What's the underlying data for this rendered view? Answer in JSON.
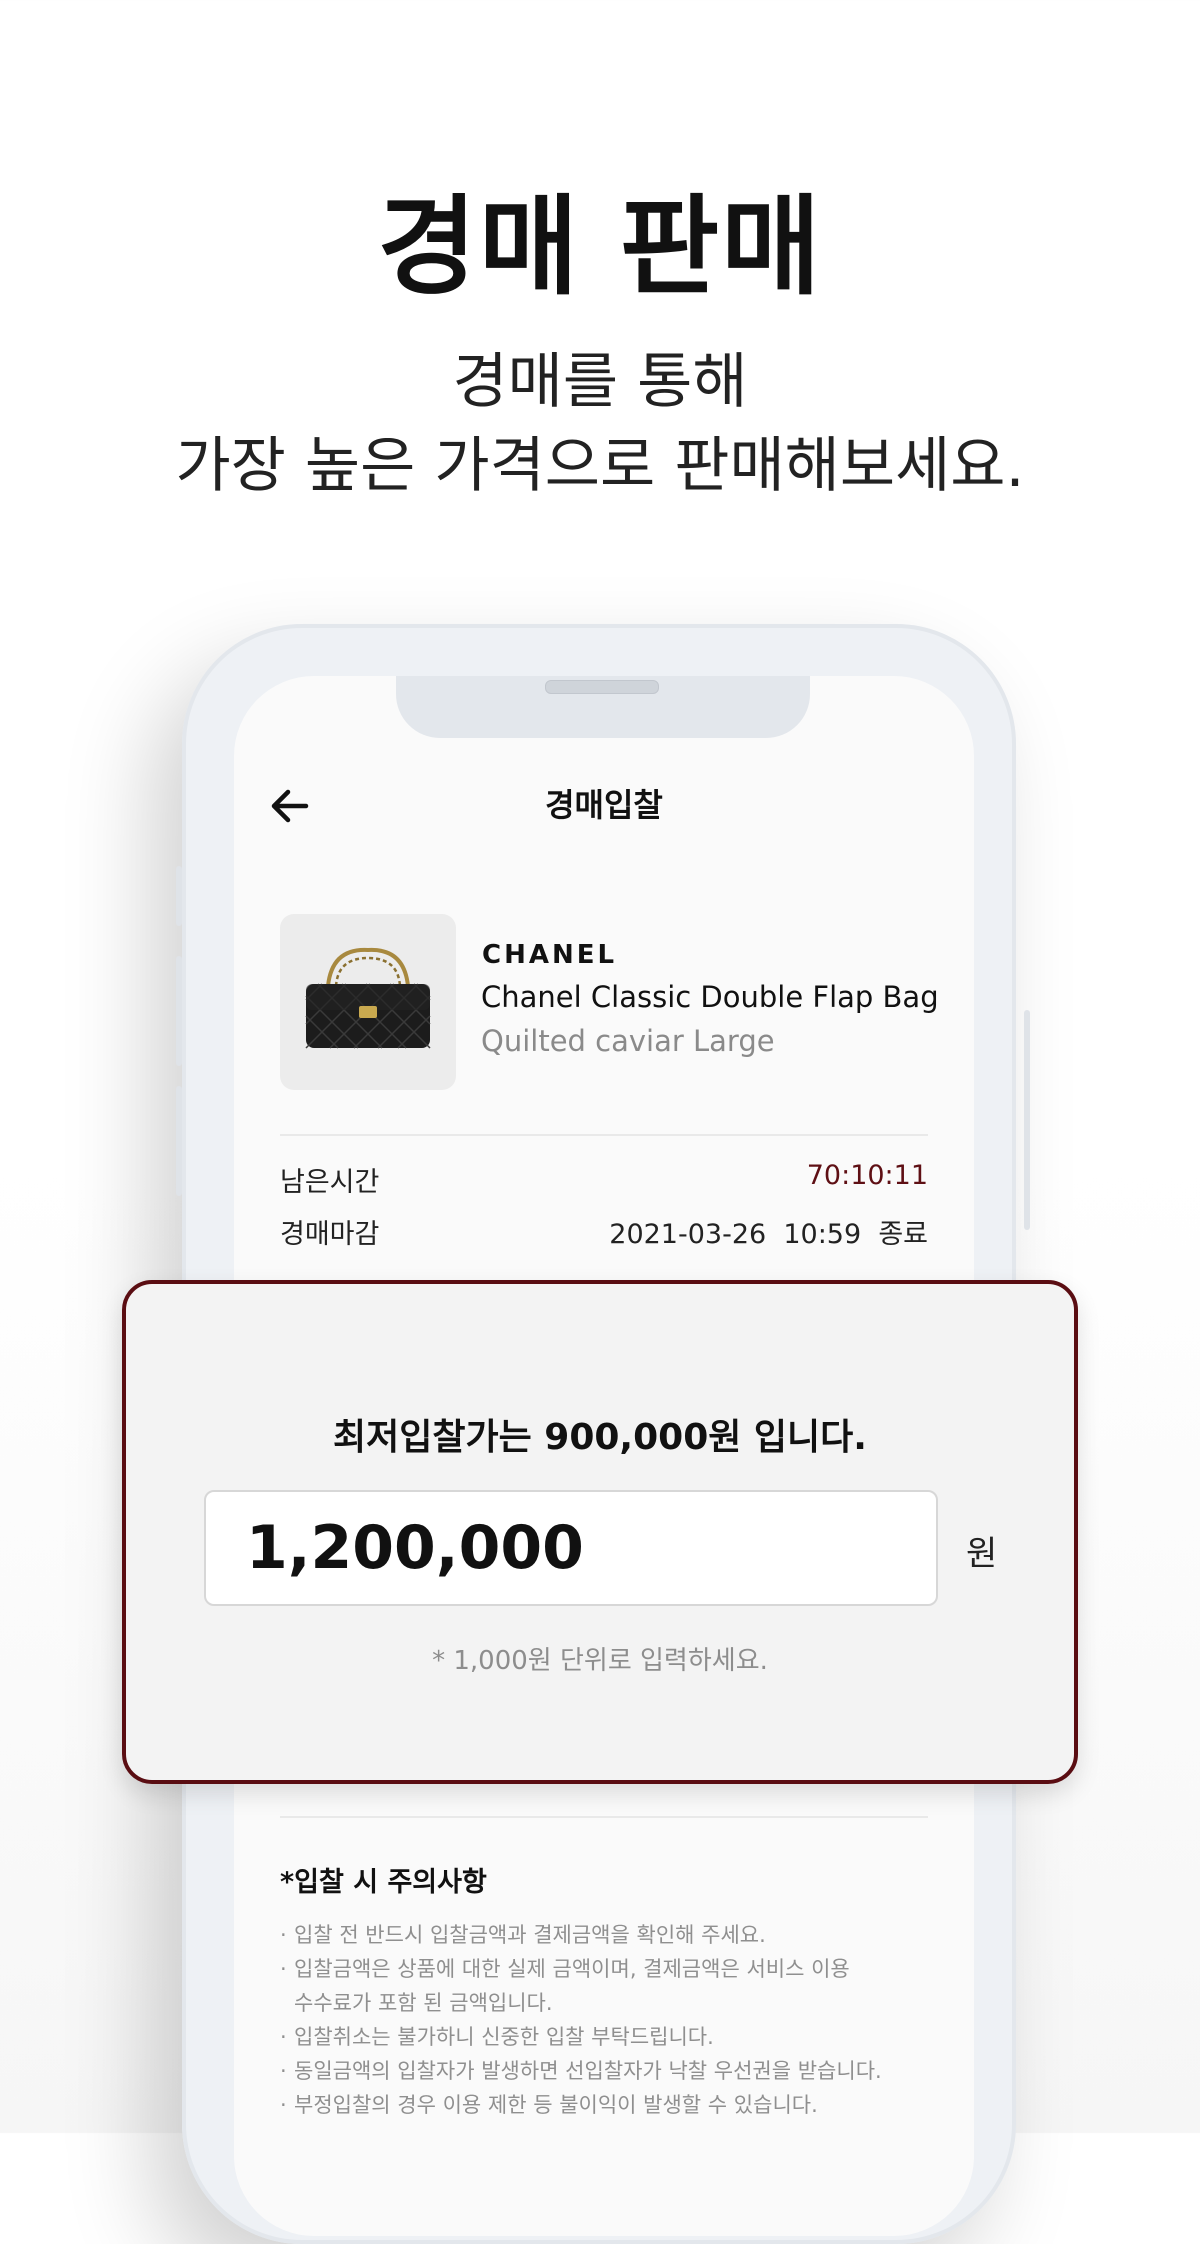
{
  "hero": {
    "title": "경매 판매",
    "subtitle_line1": "경매를 통해",
    "subtitle_line2": "가장 높은 가격으로 판매해보세요."
  },
  "screen": {
    "title": "경매입찰",
    "back_icon": "arrow-left-icon"
  },
  "product": {
    "brand": "CHANEL",
    "name": "Chanel Classic Double Flap Bag",
    "variant": "Quilted caviar Large",
    "image_icon": "handbag-icon"
  },
  "auction": {
    "remaining_label": "남은시간",
    "remaining_value": "70:10:11",
    "deadline_label": "경매마감",
    "deadline_value": "2021-03-26  10:59  종료"
  },
  "bid": {
    "min_text": "최저입찰가는 900,000원 입니다.",
    "amount": "1,200,000",
    "unit": "원",
    "hint": "* 1,000원 단위로 입력하세요."
  },
  "caution": {
    "title": "*입찰 시 주의사항",
    "items": [
      "입찰 전 반드시 입찰금액과 결제금액을 확인해 주세요.",
      "입찰금액은 상품에 대한 실제 금액이며, 결제금액은 서비스 이용\n수수료가 포함 된 금액입니다.",
      "입찰취소는 불가하니 신중한 입찰 부탁드립니다.",
      "동일금액의 입찰자가 발생하면 선입찰자가 낙찰 우선권을 받습니다.",
      "부정입찰의 경우 이용 제한 등 불이익이 발생할 수 있습니다."
    ]
  },
  "colors": {
    "accent": "#5a0d12",
    "remaining_time": "#5e0f14"
  }
}
